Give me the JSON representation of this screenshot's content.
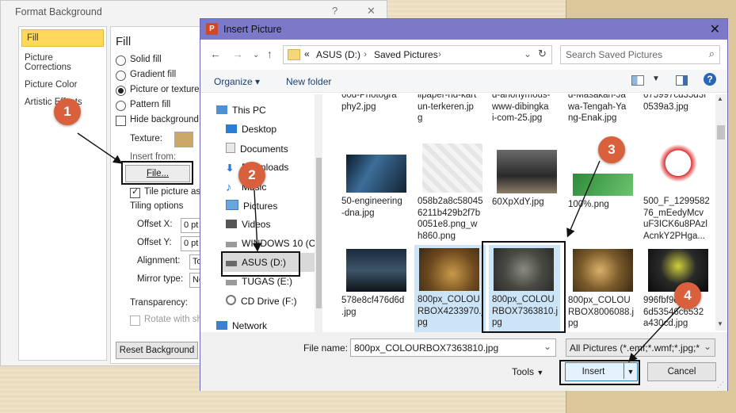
{
  "format_background": {
    "title": "Format Background",
    "help": "?",
    "close": "✕",
    "nav": [
      "Fill",
      "Picture Corrections",
      "Picture Color",
      "Artistic Effects"
    ],
    "section_title": "Fill",
    "options": [
      "Solid fill",
      "Gradient fill",
      "Picture or texture fill",
      "Pattern fill"
    ],
    "hide_graphics": "Hide background graphics",
    "texture_label": "Texture:",
    "insert_from": "Insert from:",
    "file_button": "File...",
    "tile_label": "Tile picture as texture",
    "tiling_options": "Tiling options",
    "offset_x_label": "Offset X:",
    "offset_x": "0 pt",
    "offset_y_label": "Offset Y:",
    "offset_y": "0 pt",
    "alignment_label": "Alignment:",
    "alignment": "Top left",
    "mirror_label": "Mirror type:",
    "mirror": "None",
    "transparency_label": "Transparency:",
    "rotate_label": "Rotate with shape",
    "reset_button": "Reset Background"
  },
  "dialog": {
    "title": "Insert Picture",
    "address": {
      "prefix": "«",
      "drive": "ASUS (D:)",
      "folder": "Saved Pictures"
    },
    "search_placeholder": "Search Saved Pictures",
    "organize": "Organize",
    "new_folder": "New folder",
    "tree": [
      "This PC",
      "Desktop",
      "Documents",
      "Downloads",
      "Music",
      "Pictures",
      "Videos",
      "WINDOWS 10 (C:)",
      "ASUS (D:)",
      "TUGAS (E:)",
      "CD Drive (F:)",
      "Network"
    ],
    "files_row0": [
      "60d-Photogra\nphy2.jpg",
      "llpaper-hd-kart\nun-terkeren.jp\ng",
      "d-anonymous-\nwww-dibingka\ni-com-25.jpg",
      "d-Masakan-Ja\nwa-Tengah-Ya\nng-Enak.jpg",
      "675997cd35d3f\n0539a3.jpg"
    ],
    "files_row1": [
      "50-engineering\n-dna.jpg",
      "058b2a8c58045\n6211b429b2f7b\n0051e8.png_w\nh860.png",
      "60XpXdY.jpg",
      "100%.png",
      "500_F_1299582\n76_mEedyMcv\nuF3ICK6u8PAzl\nAcnkY2PHga..."
    ],
    "files_row2": [
      "578e8cf476d6d\n.jpg",
      "800px_COLOU\nRBOX4233970.j\npg",
      "800px_COLOU\nRBOX7363810.j\npg",
      "800px_COLOU\nRBOX8006088.j\npg",
      "996fbf9e4a34\n6d53546c6532\na430cd.jpg"
    ],
    "file_name_label": "File name:",
    "file_name": "800px_COLOURBOX7363810.jpg",
    "file_type": "All Pictures (*.emf;*.wmf;*.jpg;*",
    "tools": "Tools",
    "insert": "Insert",
    "cancel": "Cancel"
  },
  "markers": [
    "1",
    "2",
    "3",
    "4"
  ]
}
